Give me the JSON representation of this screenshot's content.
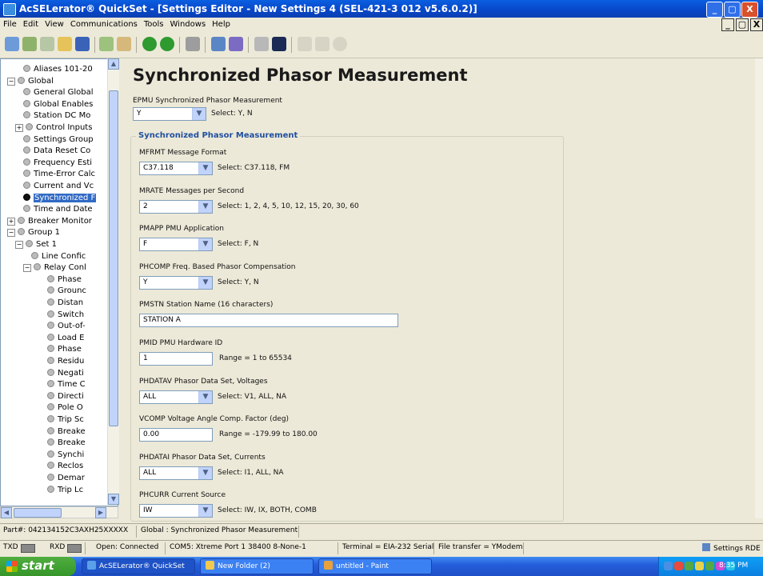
{
  "window": {
    "title": "AcSELerator® QuickSet - [Settings Editor - New Settings 4 (SEL-421-3 012 v5.6.0.2)]",
    "min": "_",
    "max": "▢",
    "close": "X"
  },
  "menu": [
    "File",
    "Edit",
    "View",
    "Communications",
    "Tools",
    "Windows",
    "Help"
  ],
  "mdi_controls": [
    "_",
    "▢",
    "X"
  ],
  "toolbar_icons": [
    "new-icon",
    "open-icon",
    "copy-icon",
    "folder-icon",
    "save-icon",
    "import-icon",
    "export-icon",
    "go-green-icon",
    "go-up-icon",
    "settings-icon",
    "send-icon",
    "receive-icon",
    "terminal-icon",
    "hmi-icon",
    "report-icon",
    "list-icon",
    "gear-icon"
  ],
  "tree": [
    {
      "label": "Aliases 101-20",
      "indent": 2,
      "pm": "",
      "bullet": true
    },
    {
      "label": "Global",
      "indent": 0,
      "pm": "−",
      "bullet": true
    },
    {
      "label": "General Global",
      "indent": 2,
      "pm": "",
      "bullet": true
    },
    {
      "label": "Global Enables",
      "indent": 2,
      "pm": "",
      "bullet": true
    },
    {
      "label": "Station DC Mo",
      "indent": 2,
      "pm": "",
      "bullet": true
    },
    {
      "label": "Control Inputs",
      "indent": 1,
      "pm": "+",
      "bullet": true
    },
    {
      "label": "Settings Group",
      "indent": 2,
      "pm": "",
      "bullet": true
    },
    {
      "label": "Data Reset Co",
      "indent": 2,
      "pm": "",
      "bullet": true
    },
    {
      "label": "Frequency Esti",
      "indent": 2,
      "pm": "",
      "bullet": true
    },
    {
      "label": "Time-Error Calc",
      "indent": 2,
      "pm": "",
      "bullet": true
    },
    {
      "label": "Current and Vc",
      "indent": 2,
      "pm": "",
      "bullet": true
    },
    {
      "label": "Synchronized F",
      "indent": 2,
      "pm": "",
      "bullet": true,
      "selected": true
    },
    {
      "label": "Time and Date",
      "indent": 2,
      "pm": "",
      "bullet": true
    },
    {
      "label": "Breaker Monitor",
      "indent": 0,
      "pm": "+",
      "bullet": true
    },
    {
      "label": "Group 1",
      "indent": 0,
      "pm": "−",
      "bullet": true
    },
    {
      "label": "Set 1",
      "indent": 1,
      "pm": "−",
      "bullet": true
    },
    {
      "label": "Line Confic",
      "indent": 3,
      "pm": "",
      "bullet": true
    },
    {
      "label": "Relay Conl",
      "indent": 2,
      "pm": "−",
      "bullet": true
    },
    {
      "label": "Phase",
      "indent": 5,
      "pm": "",
      "bullet": true
    },
    {
      "label": "Grounc",
      "indent": 5,
      "pm": "",
      "bullet": true
    },
    {
      "label": "Distan",
      "indent": 5,
      "pm": "",
      "bullet": true
    },
    {
      "label": "Switch",
      "indent": 5,
      "pm": "",
      "bullet": true
    },
    {
      "label": "Out-of-",
      "indent": 5,
      "pm": "",
      "bullet": true
    },
    {
      "label": "Load E",
      "indent": 5,
      "pm": "",
      "bullet": true
    },
    {
      "label": "Phase",
      "indent": 5,
      "pm": "",
      "bullet": true
    },
    {
      "label": "Residu",
      "indent": 5,
      "pm": "",
      "bullet": true
    },
    {
      "label": "Negati",
      "indent": 5,
      "pm": "",
      "bullet": true
    },
    {
      "label": "Time C",
      "indent": 5,
      "pm": "",
      "bullet": true
    },
    {
      "label": "Directi",
      "indent": 5,
      "pm": "",
      "bullet": true
    },
    {
      "label": "Pole O",
      "indent": 5,
      "pm": "",
      "bullet": true
    },
    {
      "label": "Trip Sc",
      "indent": 5,
      "pm": "",
      "bullet": true
    },
    {
      "label": "Breake",
      "indent": 5,
      "pm": "",
      "bullet": true
    },
    {
      "label": "Breake",
      "indent": 5,
      "pm": "",
      "bullet": true
    },
    {
      "label": "Synchi",
      "indent": 5,
      "pm": "",
      "bullet": true
    },
    {
      "label": "Reclos",
      "indent": 5,
      "pm": "",
      "bullet": true
    },
    {
      "label": "Demar",
      "indent": 5,
      "pm": "",
      "bullet": true
    },
    {
      "label": "Trip Lc",
      "indent": 5,
      "pm": "",
      "bullet": true
    }
  ],
  "page": {
    "title": "Synchronized Phasor Measurement",
    "epmu": {
      "label": "EPMU  Synchronized Phasor Measurement",
      "value": "Y",
      "hint": "Select: Y, N"
    },
    "group_title": "Synchronized Phasor Measurement",
    "fields": [
      {
        "label": "MFRMT  Message Format",
        "type": "dropdown",
        "value": "C37.118",
        "hint": "Select: C37.118, FM"
      },
      {
        "label": "MRATE  Messages per Second",
        "type": "dropdown",
        "value": "2",
        "hint": "Select: 1, 2, 4, 5, 10, 12, 15, 20, 30, 60"
      },
      {
        "label": "PMAPP  PMU Application",
        "type": "dropdown",
        "value": "F",
        "hint": "Select: F, N"
      },
      {
        "label": "PHCOMP  Freq. Based Phasor Compensation",
        "type": "dropdown",
        "value": "Y",
        "hint": "Select: Y, N"
      },
      {
        "label": "PMSTN  Station Name (16 characters)",
        "type": "wide",
        "value": "STATION A",
        "hint": ""
      },
      {
        "label": "PMID  PMU Hardware ID",
        "type": "text",
        "value": "1",
        "hint": "Range = 1 to 65534"
      },
      {
        "label": "PHDATAV  Phasor Data Set, Voltages",
        "type": "dropdown",
        "value": "ALL",
        "hint": "Select: V1, ALL, NA"
      },
      {
        "label": "VCOMP  Voltage Angle Comp. Factor (deg)",
        "type": "text",
        "value": "0.00",
        "hint": "Range = -179.99 to 180.00"
      },
      {
        "label": "PHDATAI  Phasor Data Set, Currents",
        "type": "dropdown",
        "value": "ALL",
        "hint": "Select: I1, ALL, NA"
      },
      {
        "label": "PHCURR  Current Source",
        "type": "dropdown",
        "value": "IW",
        "hint": "Select: IW, IX, BOTH, COMB"
      }
    ]
  },
  "status1": {
    "part": "Part#: 042134152C3AXH25XXXXX",
    "location": "Global : Synchronized Phasor Measurement"
  },
  "status2": {
    "txd": "TXD",
    "rxd": "RXD",
    "open": "Open: Connected",
    "port": "COM5: Xtreme Port 1  38400  8-None-1",
    "terminal": "Terminal = EIA-232 Serial",
    "transfer": "File transfer = YModem",
    "right": "Settings RDE"
  },
  "taskbar": {
    "start": "start",
    "tasks": [
      {
        "label": "AcSELerator® QuickSet",
        "active": true,
        "color": "#5aa0e8"
      },
      {
        "label": "New Folder (2)",
        "active": false,
        "color": "#f2c94c"
      },
      {
        "label": "untitled - Paint",
        "active": false,
        "color": "#e8a23c"
      }
    ],
    "clock": "8:35 PM",
    "tray_colors": [
      "#4a90e2",
      "#e84a3c",
      "#56a845",
      "#e8d24a",
      "#56a845",
      "#d44ad4",
      "#2ac4e8"
    ]
  },
  "colors": {
    "accent": "#316AC5",
    "group_title": "#1f4fa0",
    "title_bar": "#0A5FE0"
  }
}
